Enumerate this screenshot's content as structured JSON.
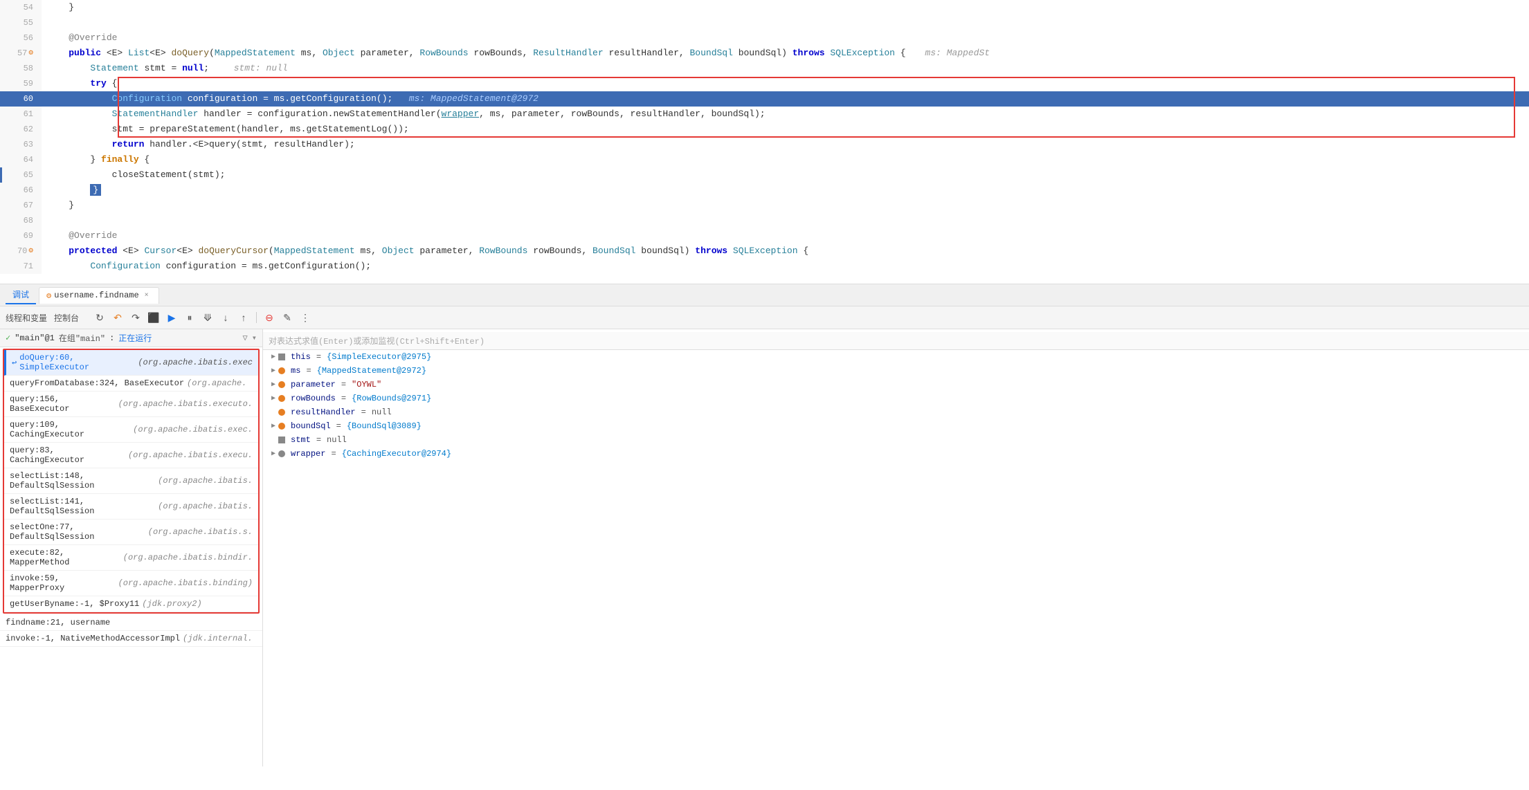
{
  "editor": {
    "lines": [
      {
        "num": "54",
        "content": "    }",
        "indent": 4,
        "type": "normal"
      },
      {
        "num": "55",
        "content": "",
        "type": "normal"
      },
      {
        "num": "56",
        "content": "    @Override",
        "type": "annotation"
      },
      {
        "num": "57",
        "content": "    public <E> List<E> doQuery(MappedStatement ms, Object parameter, RowBounds rowBounds, ResultHandler resultHandler, BoundSql boundSql) throws SQLException {",
        "type": "signature",
        "hint": "ms: MappedSt"
      },
      {
        "num": "58",
        "content": "        Statement stmt = null;",
        "type": "normal",
        "hint": "stmt: null"
      },
      {
        "num": "59",
        "content": "        try {",
        "type": "normal"
      },
      {
        "num": "60",
        "content": "            Configuration configuration = ms.getConfiguration();",
        "type": "highlighted",
        "hint": "ms: MappedStatement@2972"
      },
      {
        "num": "61",
        "content": "            StatementHandler handler = configuration.newStatementHandler(wrapper, ms, parameter, rowBounds, resultHandler, boundSql);",
        "type": "normal"
      },
      {
        "num": "62",
        "content": "            stmt = prepareStatement(handler, ms.getStatementLog());",
        "type": "normal"
      },
      {
        "num": "63",
        "content": "            return handler.<E>query(stmt, resultHandler);",
        "type": "normal"
      },
      {
        "num": "64",
        "content": "        } finally {",
        "type": "finally"
      },
      {
        "num": "65",
        "content": "            closeStatement(stmt);",
        "type": "normal"
      },
      {
        "num": "66",
        "content": "        }",
        "type": "normal"
      },
      {
        "num": "67",
        "content": "    }",
        "type": "normal"
      },
      {
        "num": "68",
        "content": "",
        "type": "normal"
      },
      {
        "num": "69",
        "content": "    @Override",
        "type": "annotation"
      },
      {
        "num": "70",
        "content": "    protected <E> Cursor<E> doQueryCursor(MappedStatement ms, Object parameter, RowBounds rowBounds, BoundSql boundSql) throws SQLException {",
        "type": "signature2"
      },
      {
        "num": "71",
        "content": "        Configuration configuration = ms.getConfiguration();",
        "type": "normal"
      }
    ]
  },
  "debug": {
    "tab1": "调试",
    "tab2_icon": "debug-icon",
    "tab2": "username.findname",
    "tab2_close": "×",
    "toolbar_buttons": [
      "↻",
      "↶",
      "↷",
      "⬛",
      "▶",
      "⏸",
      "⟱",
      "↓",
      "↑",
      "⊖",
      "✎",
      "⋮"
    ],
    "thread_label": "\"main\"@1",
    "thread_group": "在组\"main\"",
    "thread_status": "正在运行",
    "input_placeholder": "对表达式求值(Enter)或添加监视(Ctrl+Shift+Enter)",
    "stack_frames": [
      {
        "method": "doQuery:60, SimpleExecutor",
        "class": "(org.apache.ibatis.exec",
        "active": true
      },
      {
        "method": "queryFromDatabase:324, BaseExecutor",
        "class": "(org.apache.",
        "active": false
      },
      {
        "method": "query:156, BaseExecutor",
        "class": "(org.apache.ibatis.executo.",
        "active": false
      },
      {
        "method": "query:109, CachingExecutor",
        "class": "(org.apache.ibatis.exec.",
        "active": false
      },
      {
        "method": "query:83, CachingExecutor",
        "class": "(org.apache.ibatis.execu.",
        "active": false
      },
      {
        "method": "selectList:148, DefaultSqlSession",
        "class": "(org.apache.ibatis.",
        "active": false
      },
      {
        "method": "selectList:141, DefaultSqlSession",
        "class": "(org.apache.ibatis.",
        "active": false
      },
      {
        "method": "selectOne:77, DefaultSqlSession",
        "class": "(org.apache.ibatis.s.",
        "active": false
      },
      {
        "method": "execute:82, MapperMethod",
        "class": "(org.apache.ibatis.bindir.",
        "active": false
      },
      {
        "method": "invoke:59, MapperProxy",
        "class": "(org.apache.ibatis.binding)",
        "active": false
      },
      {
        "method": "getUserByname:-1, $Proxy11",
        "class": "(jdk.proxy2)",
        "active": false
      },
      {
        "method": "findname:21, username",
        "class": "",
        "active": false
      },
      {
        "method": "invoke:-1, NativeMethodAccessorImpl",
        "class": "(jdk.internal.",
        "active": false
      }
    ],
    "variables": [
      {
        "expand": "▶",
        "icon": "bar",
        "name": "this",
        "eq": "=",
        "value": "{SimpleExecutor@2975}"
      },
      {
        "expand": "▶",
        "icon": "orange",
        "name": "ms",
        "eq": "=",
        "value": "{MappedStatement@2972}"
      },
      {
        "expand": "▶",
        "icon": "orange",
        "name": "parameter",
        "eq": "=",
        "value": "\"OYWL\""
      },
      {
        "expand": "▶",
        "icon": "orange",
        "name": "rowBounds",
        "eq": "=",
        "value": "{RowBounds@2971}"
      },
      {
        "expand": " ",
        "icon": "orange",
        "name": "resultHandler",
        "eq": "=",
        "value": "null"
      },
      {
        "expand": "▶",
        "icon": "orange",
        "name": "boundSql",
        "eq": "=",
        "value": "{BoundSql@3089}"
      },
      {
        "expand": " ",
        "icon": "bar",
        "name": "stmt",
        "eq": "=",
        "value": "null"
      },
      {
        "expand": "▶",
        "icon": "circle2",
        "name": "wrapper",
        "eq": "=",
        "value": "{CachingExecutor@2974}"
      }
    ]
  }
}
